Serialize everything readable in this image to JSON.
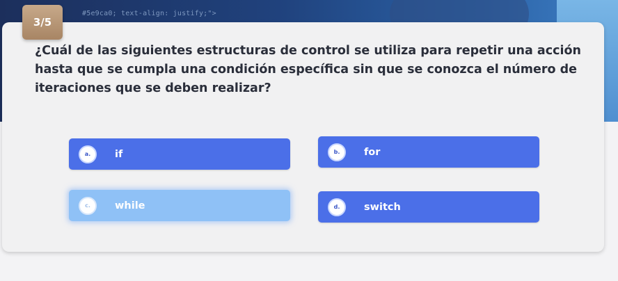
{
  "counter": "3/5",
  "header_code": "#5e9ca0; text-align: justify;\">",
  "question": "¿Cuál de las siguientes estructuras de control se utiliza para repetir una acción hasta que se cumpla una condición específica sin que se conozca el número de iteraciones que se deben realizar?",
  "options": [
    {
      "letter": "a.",
      "label": "if",
      "selected": false
    },
    {
      "letter": "b.",
      "label": "for",
      "selected": false
    },
    {
      "letter": "c.",
      "label": "while",
      "selected": true
    },
    {
      "letter": "d.",
      "label": "switch",
      "selected": false
    }
  ],
  "colors": {
    "option": "#4b6fe8",
    "option_selected": "#8fc1f6",
    "counter_badge": "#b8977a",
    "question_text": "#2a2e3a"
  }
}
